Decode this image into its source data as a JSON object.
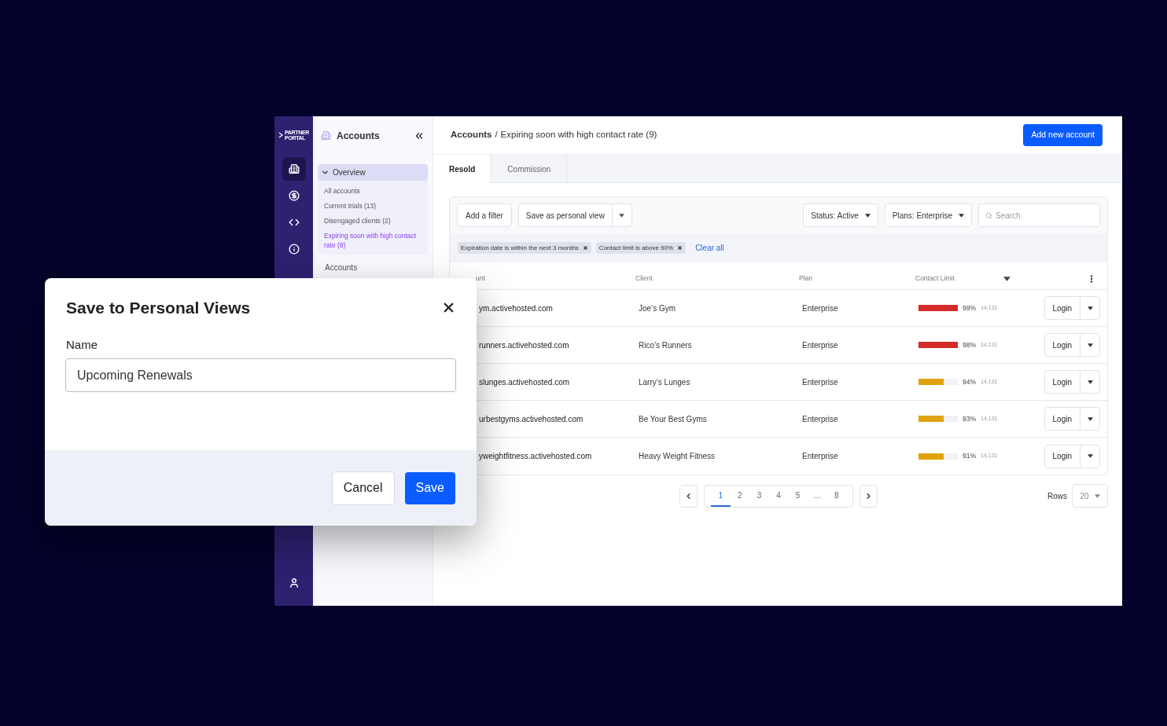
{
  "rail": {
    "logo": [
      "PARTNER",
      "PORTAL"
    ],
    "items": [
      {
        "kind": "building",
        "selected": true
      },
      {
        "kind": "dollar",
        "selected": false
      },
      {
        "kind": "code",
        "selected": false
      },
      {
        "kind": "info",
        "selected": false
      }
    ],
    "bottom": {
      "kind": "user",
      "selected": false
    }
  },
  "nav": {
    "title": "Accounts",
    "group": {
      "label": "Overview",
      "expanded": true,
      "items": [
        {
          "label": "All accounts",
          "selected": false
        },
        {
          "label": "Current trials (13)",
          "selected": false
        },
        {
          "label": "Disengaged clients (2)",
          "selected": false
        },
        {
          "label": "Expiring soon with high contact rate (9)",
          "selected": true
        }
      ]
    },
    "items": [
      {
        "label": "Accounts"
      }
    ]
  },
  "header": {
    "breadcrumb": [
      "Accounts",
      "/",
      "Expiring soon with high contact rate (9)"
    ],
    "button": "Add new account"
  },
  "tabs": [
    {
      "label": "Resold",
      "selected": true
    },
    {
      "label": "Commission",
      "selected": false
    }
  ],
  "toolbar": {
    "add_filter": "Add a filter",
    "save_view": "Save as personal view",
    "status": "Status: Active",
    "plans": "Plans: Enterprise",
    "search": {
      "placeholder": "Search"
    }
  },
  "filters": [
    {
      "label": "Expiration date is within the next 3 months"
    },
    {
      "label": "Contact limit is above 90%"
    }
  ],
  "clear_all": "Clear all",
  "table": {
    "columns": [
      "unt",
      "Client",
      "Plan",
      "Contact Limit"
    ],
    "rows": [
      {
        "account": "ym.activehosted.com",
        "client": "Joe’s Gym",
        "plan": "Enterprise",
        "level": 1,
        "color": "#d42a2a",
        "percent": "99%",
        "count": "14,131",
        "action": "Login"
      },
      {
        "account": "runners.activehosted.com",
        "client": "Rico’s Runners",
        "plan": "Enterprise",
        "level": 1,
        "color": "#d42a2a",
        "percent": "98%",
        "count": "14,131",
        "action": "Login"
      },
      {
        "account": "slunges.activehosted.com",
        "client": "Larry’s Lunges",
        "plan": "Enterprise",
        "level": 0.63,
        "color": "#e0a30e",
        "percent": "94%",
        "count": "14,131",
        "action": "Login"
      },
      {
        "account": "urbestgyms.activehosted.com",
        "client": "Be Your Best Gyms",
        "plan": "Enterprise",
        "level": 0.63,
        "color": "#e0a30e",
        "percent": "93%",
        "count": "14,131",
        "action": "Login"
      },
      {
        "account": "yweightfitness.activehosted.com",
        "client": "Heavy Weight Fitness",
        "plan": "Enterprise",
        "level": 0.63,
        "color": "#e0a30e",
        "percent": "91%",
        "count": "14,131",
        "action": "Login"
      }
    ]
  },
  "pagination": {
    "pages": [
      {
        "label": "1",
        "selected": true
      },
      {
        "label": "2",
        "selected": false
      },
      {
        "label": "3",
        "selected": false
      },
      {
        "label": "4",
        "selected": false
      },
      {
        "label": "5",
        "selected": false
      },
      {
        "label": "…",
        "selected": false
      },
      {
        "label": "8",
        "selected": false
      }
    ],
    "rows_label": "Rows",
    "rows_value": "20"
  },
  "modal": {
    "title": "Save to Personal Views",
    "label": "Name",
    "value": "Upcoming Renewals",
    "cancel": "Cancel",
    "save": "Save"
  }
}
